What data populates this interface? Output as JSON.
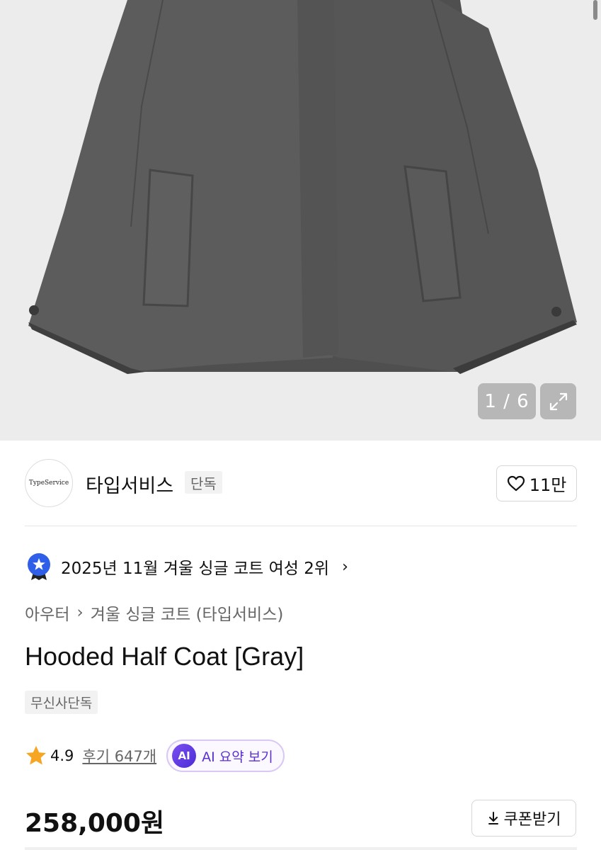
{
  "gallery": {
    "counter": "1 / 6"
  },
  "brand": {
    "logo_text": "TypeService",
    "name": "타입서비스",
    "tag": "단독",
    "likes": "11만"
  },
  "ranking": {
    "text": "2025년 11월 겨울 싱글 코트 여성 2위"
  },
  "breadcrumb": {
    "category": "아우터",
    "subcategory": "겨울 싱글 코트 (타입서비스)"
  },
  "product": {
    "title": "Hooded Half Coat [Gray]",
    "exclusive_badge": "무신사단독",
    "rating": "4.9",
    "reviews": "후기 647개",
    "ai_badge": "AI",
    "ai_summary": "AI 요약 보기",
    "price": "258,000원",
    "coupon": "쿠폰받기"
  },
  "icons": {
    "expand": "expand-icon",
    "heart": "heart-icon",
    "ranking": "ranking-badge-icon",
    "star": "star-icon",
    "download": "download-icon"
  },
  "colors": {
    "star": "#f6a623",
    "ranking_badge": "#2f5fe8",
    "ai_accent": "#5a2fd0",
    "coat": "#5b5b5b"
  }
}
